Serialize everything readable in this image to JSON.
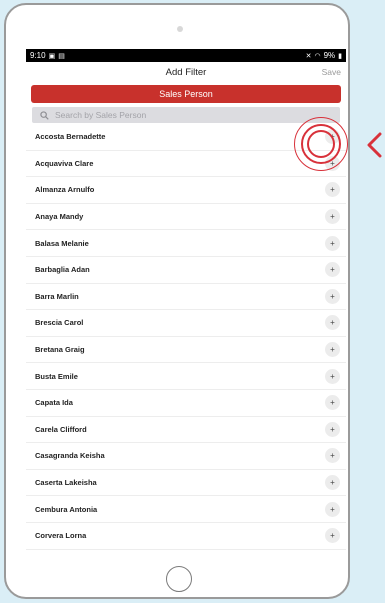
{
  "status_bar": {
    "time": "9:10",
    "battery": "9%"
  },
  "nav": {
    "title": "Add Filter",
    "save_label": "Save"
  },
  "filter_type": "Sales Person",
  "search": {
    "placeholder": "Search by Sales Person"
  },
  "add_label": "+",
  "sales_persons": [
    "Accosta Bernadette",
    "Acquaviva Clare",
    "Almanza Arnulfo",
    "Anaya Mandy",
    "Balasa Melanie",
    "Barbaglia Adan",
    "Barra Marlin",
    "Brescia Carol",
    "Bretana Graig",
    "Busta Emile",
    "Capata Ida",
    "Carela Clifford",
    "Casagranda Keisha",
    "Caserta Lakeisha",
    "Cembura Antonia",
    "Corvera Lorna"
  ],
  "colors": {
    "accent": "#c8312c",
    "highlight": "#d8313a",
    "background": "#daeef6"
  }
}
